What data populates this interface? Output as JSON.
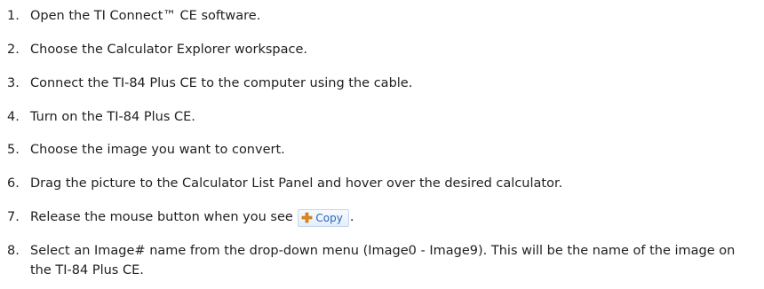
{
  "steps": [
    {
      "num": "1.",
      "text": "Open the TI Connect™ CE software."
    },
    {
      "num": "2.",
      "text": "Choose the Calculator Explorer workspace."
    },
    {
      "num": "3.",
      "text": "Connect the TI-84 Plus CE to the computer using the cable."
    },
    {
      "num": "4.",
      "text": "Turn on the TI-84 Plus CE."
    },
    {
      "num": "5.",
      "text": "Choose the image you want to convert."
    },
    {
      "num": "6.",
      "text": "Drag the picture to the Calculator List Panel and hover over the desired calculator."
    },
    {
      "num": "7.",
      "text_before": "Release the mouse button when you see ",
      "badge_label": "Copy",
      "text_after": "."
    },
    {
      "num": "8.",
      "text": "Select an Image# name from the drop-down menu (Image0 - Image9). This will be the name of the image on the TI-84 Plus CE."
    }
  ],
  "badge_icon": "plus-icon",
  "colors": {
    "text": "#1f1f1f",
    "badge_text": "#2b66b5",
    "badge_plus": "#e08a1e"
  }
}
